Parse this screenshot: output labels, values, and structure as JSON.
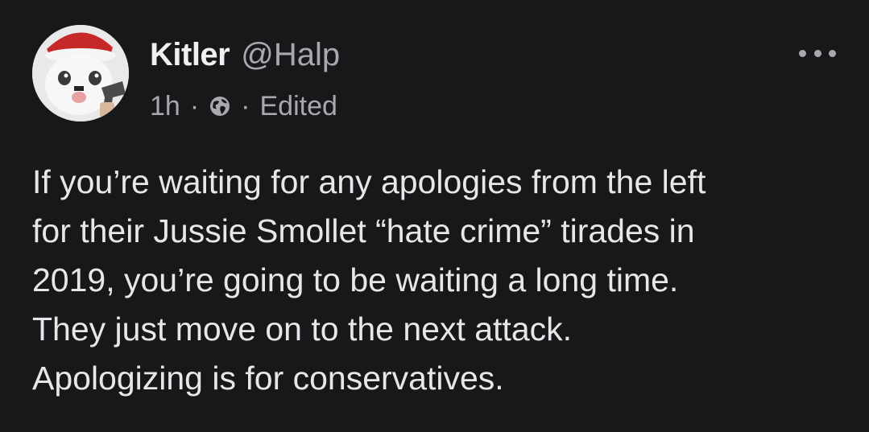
{
  "post": {
    "author": {
      "display_name": "Kitler",
      "handle": "@Halp",
      "avatar_icon": "cat-with-santa-hat-and-pistol-avatar"
    },
    "meta": {
      "time": "1h",
      "separator": "·",
      "visibility_icon": "globe-icon",
      "edited_label": "Edited"
    },
    "more_icon": "more-options-icon",
    "body_lines": [
      "If you’re waiting for any apologies from the left",
      "for their Jussie Smollet “hate crime” tirades in",
      "2019, you’re going to be waiting a long time.",
      "They just move on to the next attack.",
      "Apologizing is for conservatives."
    ]
  },
  "colors": {
    "background": "#18181b",
    "primary_text": "#e7e7ea",
    "secondary_text": "#a9a9ad"
  }
}
